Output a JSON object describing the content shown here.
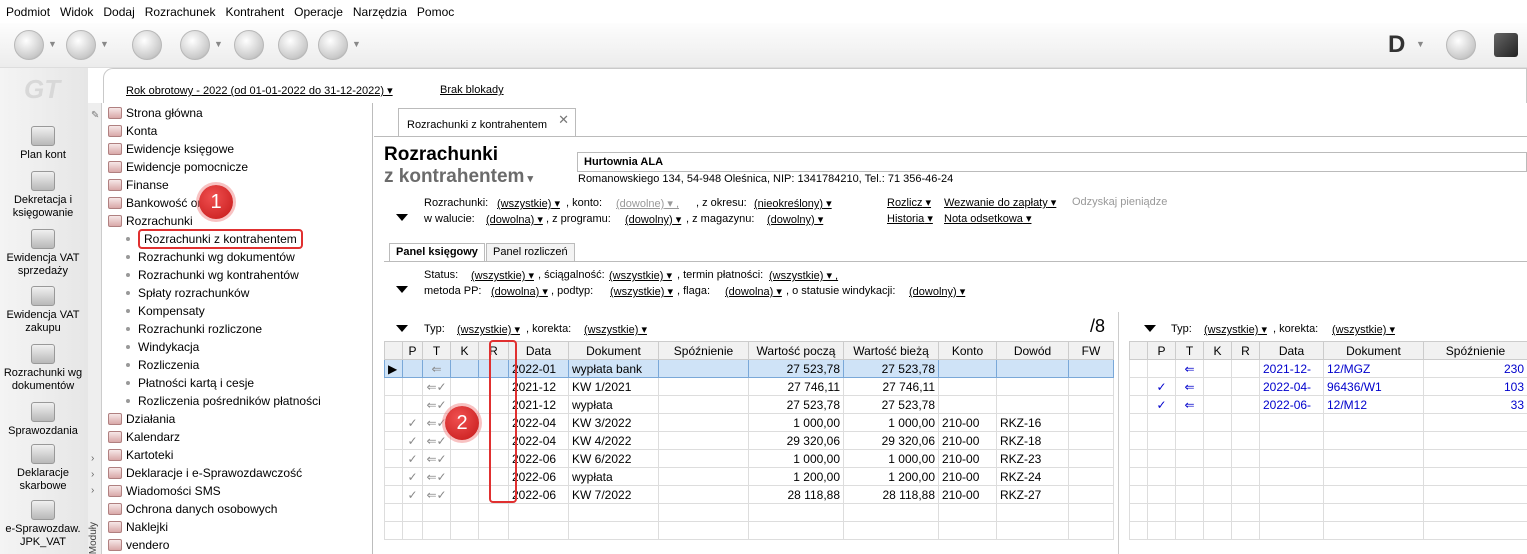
{
  "menu": [
    "Podmiot",
    "Widok",
    "Dodaj",
    "Rozrachunek",
    "Kontrahent",
    "Operacje",
    "Narzędzia",
    "Pomoc"
  ],
  "toolbar": {
    "right_letter": "D"
  },
  "left_modules": [
    {
      "label": "Plan kont"
    },
    {
      "label": "Dekretacja i księgowanie"
    },
    {
      "label": "Ewidencja VAT sprzedaży"
    },
    {
      "label": "Ewidencja VAT zakupu"
    },
    {
      "label": "Rozrachunki wg dokumentów"
    },
    {
      "label": "Sprawozdania"
    },
    {
      "label": "Deklaracje skarbowe"
    },
    {
      "label": "e-Sprawozdaw. JPK_VAT"
    }
  ],
  "logo_text": "GT",
  "yearbar": {
    "year": "Rok obrotowy - 2022  (od 01-01-2022 do 31-12-2022)",
    "lock": "Brak blokady"
  },
  "tree": {
    "vertical_tab": "Moduły",
    "items": [
      {
        "label": "Strona główna"
      },
      {
        "label": "Konta"
      },
      {
        "label": "Ewidencje księgowe"
      },
      {
        "label": "Ewidencje pomocnicze"
      },
      {
        "label": "Finanse"
      },
      {
        "label": "Bankowość on-line"
      },
      {
        "label": "Rozrachunki"
      },
      {
        "label": "Rozrachunki z kontrahentem"
      },
      {
        "label": "Rozrachunki wg dokumentów"
      },
      {
        "label": "Rozrachunki wg kontrahentów"
      },
      {
        "label": "Spłaty rozrachunków"
      },
      {
        "label": "Kompensaty"
      },
      {
        "label": "Rozrachunki rozliczone"
      },
      {
        "label": "Windykacja"
      },
      {
        "label": "Rozliczenia"
      },
      {
        "label": "Płatności kartą i cesje"
      },
      {
        "label": "Rozliczenia pośredników płatności"
      },
      {
        "label": "Działania"
      },
      {
        "label": "Kalendarz"
      },
      {
        "label": "Kartoteki"
      },
      {
        "label": "Deklaracje i e-Sprawozdawczość"
      },
      {
        "label": "Wiadomości SMS"
      },
      {
        "label": "Ochrona danych osobowych"
      },
      {
        "label": "Naklejki"
      },
      {
        "label": "vendero"
      }
    ]
  },
  "badges": {
    "one": "1",
    "two": "2"
  },
  "doc_tab": "Rozrachunki z kontrahentem",
  "header": {
    "title1": "Rozrachunki",
    "title2": "z kontrahentem"
  },
  "kontrahent": {
    "name": "Hurtownia ALA",
    "address": "Romanowskiego 134, 54-948 Oleśnica, NIP: 1341784210, Tel.: 71 356-46-24"
  },
  "filters": {
    "rozrachunki_lbl": "Rozrachunki:",
    "rozrachunki": "(wszystkie)",
    "konto_lbl": ", konto:",
    "konto": "(dowolne)",
    "okres_lbl": ", z okresu:",
    "okres": "(nieokreślony)",
    "waluta_lbl": "w walucie:",
    "waluta": "(dowolna)",
    "program_lbl": ", z programu:",
    "program": "(dowolny)",
    "magazyn_lbl": ", z magazynu:",
    "magazyn": "(dowolny)",
    "rozlicz": "Rozlicz",
    "wezwanie": "Wezwanie do zapłaty",
    "odzyskaj": "Odzyskaj pieniądze",
    "historia": "Historia",
    "nota": "Nota odsetkowa"
  },
  "panels": {
    "ksiegowy": "Panel księgowy",
    "rozliczen": "Panel rozliczeń"
  },
  "panel_filters": {
    "status_lbl": "Status:",
    "status": "(wszystkie)",
    "sciag_lbl": ", ściągalność:",
    "sciag": "(wszystkie)",
    "termin_lbl": ", termin płatności:",
    "termin": "(wszystkie)",
    "metoda_lbl": "metoda PP:",
    "metoda": "(dowolna)",
    "podtyp_lbl": ", podtyp:",
    "podtyp": "(wszystkie)",
    "flaga_lbl": ", flaga:",
    "flaga": "(dowolna)",
    "windyk_lbl": ", o statusie windykacji:",
    "windyk": "(dowolny)"
  },
  "left_grid": {
    "typ_lbl": "Typ:",
    "typ": "(wszystkie)",
    "korekta_lbl": ", korekta:",
    "korekta": "(wszystkie)",
    "count": "/8",
    "columns": [
      "P",
      "T",
      "K",
      "R",
      "Data",
      "Dokument",
      "Spóźnienie",
      "Wartość począ",
      "Wartość bieżą",
      "Konto",
      "Dowód",
      "FW"
    ],
    "rows": [
      [
        "",
        "⇐",
        "",
        "",
        "2022-01",
        "wypłata bank",
        "",
        "27 523,78",
        "27 523,78",
        "",
        "",
        ""
      ],
      [
        "",
        "⇐✓",
        "",
        "",
        "2021-12",
        "KW 1/2021",
        "",
        "27 746,11",
        "27 746,11",
        "",
        "",
        ""
      ],
      [
        "",
        "⇐✓",
        "",
        "",
        "2021-12",
        "wypłata",
        "",
        "27 523,78",
        "27 523,78",
        "",
        "",
        ""
      ],
      [
        "✓",
        "⇐✓",
        "",
        "",
        "2022-04",
        "KW 3/2022",
        "",
        "1 000,00",
        "1 000,00",
        "210-00",
        "RKZ-16",
        ""
      ],
      [
        "✓",
        "⇐✓",
        "",
        "",
        "2022-04",
        "KW 4/2022",
        "",
        "29 320,06",
        "29 320,06",
        "210-00",
        "RKZ-18",
        ""
      ],
      [
        "✓",
        "⇐✓",
        "",
        "",
        "2022-06",
        "KW 6/2022",
        "",
        "1 000,00",
        "1 000,00",
        "210-00",
        "RKZ-23",
        ""
      ],
      [
        "✓",
        "⇐✓",
        "",
        "",
        "2022-06",
        "wypłata",
        "",
        "1 200,00",
        "1 200,00",
        "210-00",
        "RKZ-24",
        ""
      ],
      [
        "✓",
        "⇐✓",
        "",
        "",
        "2022-06",
        "KW 7/2022",
        "",
        "28 118,88",
        "28 118,88",
        "210-00",
        "RKZ-27",
        ""
      ],
      [
        "",
        "",
        "",
        "",
        "",
        "",
        "",
        "",
        "",
        "",
        "",
        ""
      ],
      [
        "",
        "",
        "",
        "",
        "",
        "",
        "",
        "",
        "",
        "",
        "",
        ""
      ]
    ]
  },
  "right_grid": {
    "typ_lbl": "Typ:",
    "typ": "(wszystkie)",
    "korekta_lbl": ", korekta:",
    "korekta": "(wszystkie)",
    "columns": [
      "P",
      "T",
      "K",
      "R",
      "Data",
      "Dokument",
      "Spóźnienie"
    ],
    "rows": [
      [
        "",
        "⇐",
        "",
        "",
        "2021-12-",
        "12/MGZ",
        "230"
      ],
      [
        "✓",
        "⇐",
        "",
        "",
        "2022-04-",
        "96436/W1",
        "103"
      ],
      [
        "✓",
        "⇐",
        "",
        "",
        "2022-06-",
        "12/M12",
        "33"
      ],
      [
        "",
        "",
        "",
        "",
        "",
        "",
        ""
      ],
      [
        "",
        "",
        "",
        "",
        "",
        "",
        ""
      ],
      [
        "",
        "",
        "",
        "",
        "",
        "",
        ""
      ],
      [
        "",
        "",
        "",
        "",
        "",
        "",
        ""
      ],
      [
        "",
        "",
        "",
        "",
        "",
        "",
        ""
      ],
      [
        "",
        "",
        "",
        "",
        "",
        "",
        ""
      ],
      [
        "",
        "",
        "",
        "",
        "",
        "",
        ""
      ]
    ]
  }
}
